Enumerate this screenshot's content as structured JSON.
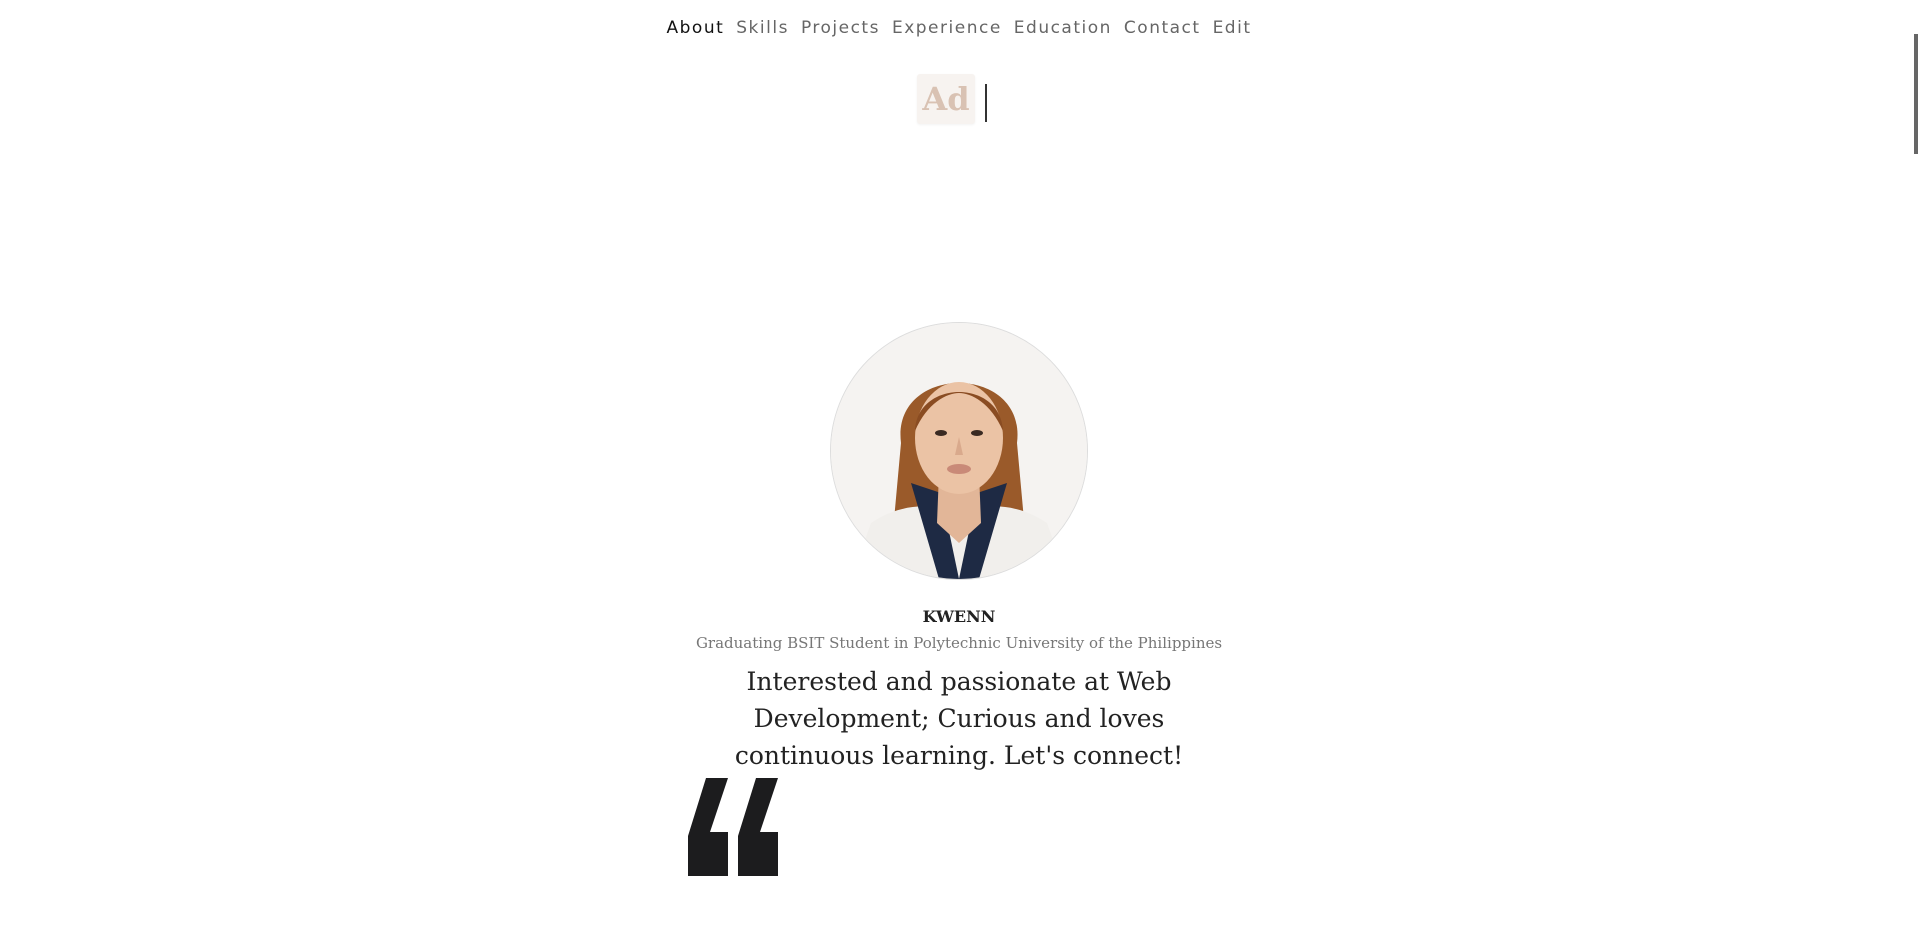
{
  "nav": {
    "items": [
      {
        "label": "About"
      },
      {
        "label": "Skills"
      },
      {
        "label": "Projects"
      },
      {
        "label": "Experience"
      },
      {
        "label": "Education"
      },
      {
        "label": "Contact"
      },
      {
        "label": "Edit"
      }
    ],
    "active": "About"
  },
  "logo": {
    "text": "Ad"
  },
  "profile": {
    "name": "KWENN",
    "subtitle": "Graduating BSIT Student in Polytechnic University of the Philippines",
    "tagline": "Interested and passionate at Web Development; Curious and loves continuous learning. Let's connect!"
  },
  "colors": {
    "accent": "#d9c2b3",
    "text": "#222222",
    "muted": "#777777"
  },
  "icons": {
    "quote": "quote-mark-icon"
  }
}
